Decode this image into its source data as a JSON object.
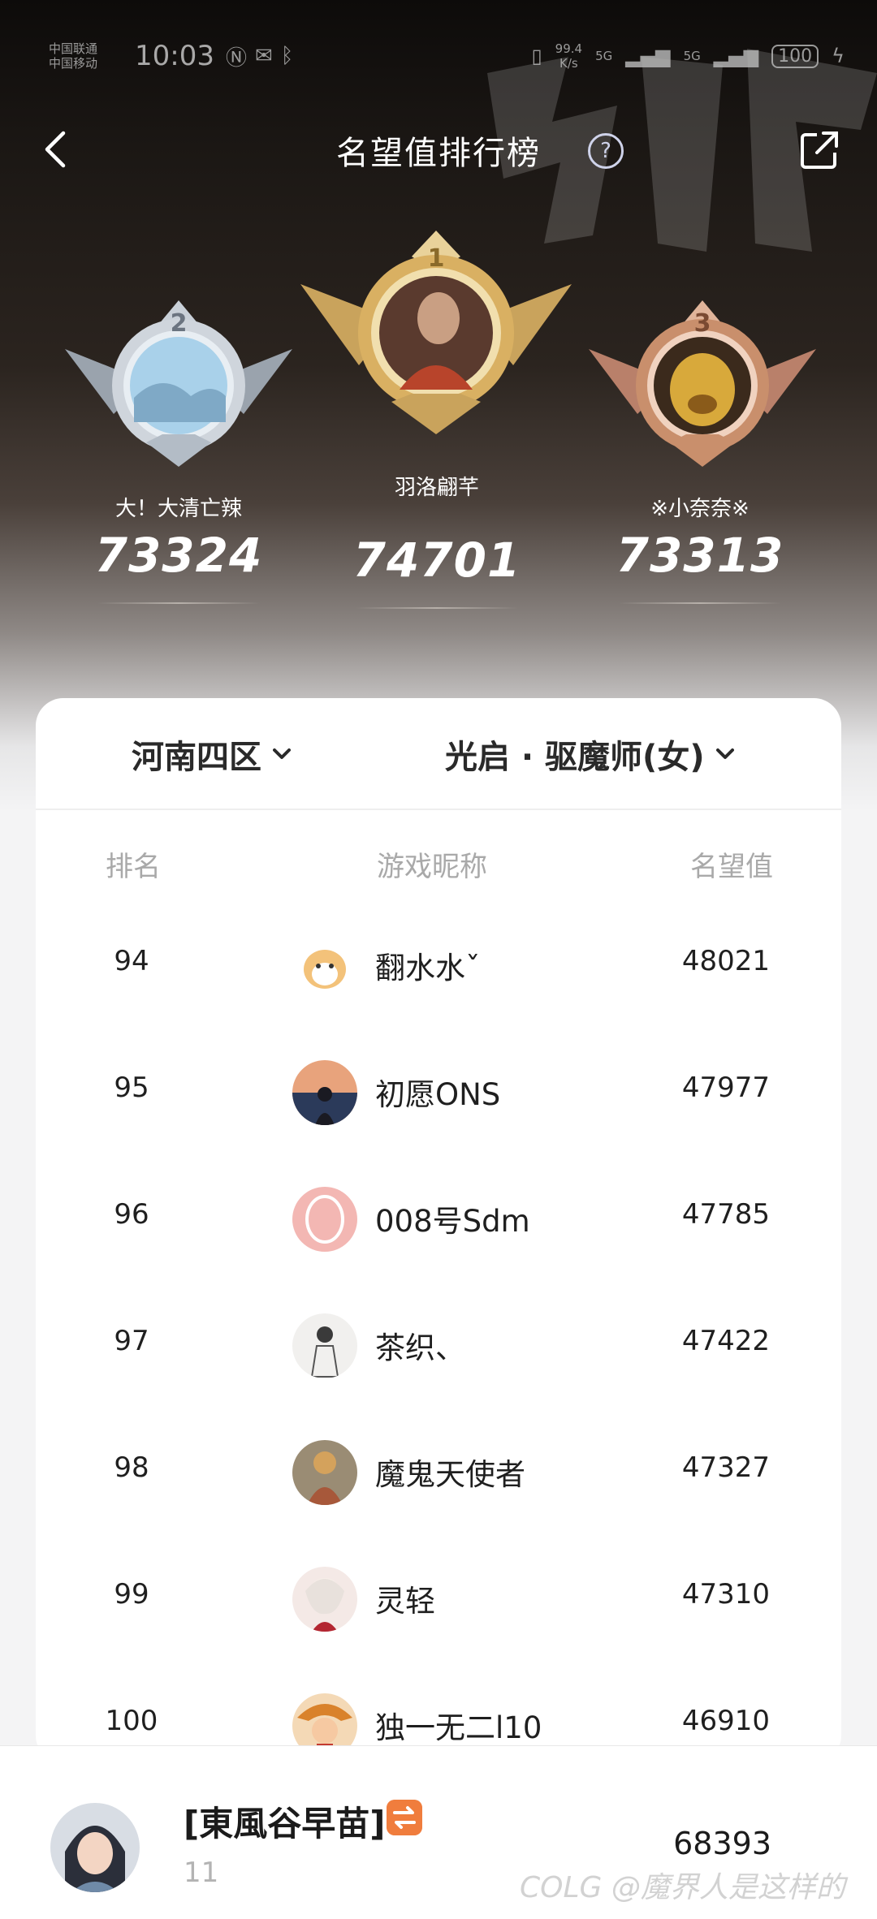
{
  "status_bar": {
    "carrier_1": "中国联通",
    "carrier_2": "中国移动",
    "time": "10:03",
    "net_speed_value": "99.4",
    "net_speed_unit": "K/s",
    "signal_1": "5G",
    "signal_2": "5G",
    "battery": "100"
  },
  "header": {
    "title": "名望值排行榜",
    "help_label": "?"
  },
  "podium": [
    {
      "rank": "2",
      "name": "大！大清亡辣",
      "score": "73324"
    },
    {
      "rank": "1",
      "name": "羽洛翩芊",
      "score": "74701"
    },
    {
      "rank": "3",
      "name": "※小奈奈※",
      "score": "73313"
    }
  ],
  "filters": {
    "server": "河南四区",
    "job": "光启 · 驱魔师(女)"
  },
  "table": {
    "headers": {
      "rank": "排名",
      "nickname": "游戏昵称",
      "score": "名望值"
    },
    "rows": [
      {
        "rank": "94",
        "nickname": "翻水水ˇ",
        "score": "48021"
      },
      {
        "rank": "95",
        "nickname": "初愿ONS",
        "score": "47977"
      },
      {
        "rank": "96",
        "nickname": "008号Sdm",
        "score": "47785"
      },
      {
        "rank": "97",
        "nickname": "茶织、",
        "score": "47422"
      },
      {
        "rank": "98",
        "nickname": "魔鬼天使者",
        "score": "47327"
      },
      {
        "rank": "99",
        "nickname": "灵轻",
        "score": "47310"
      },
      {
        "rank": "100",
        "nickname": "独一无二l10",
        "score": "46910"
      }
    ]
  },
  "me": {
    "name": "[東風谷早苗]",
    "rank": "11",
    "score": "68393"
  },
  "watermark": "COLG @魔界人是这样的",
  "colors": {
    "accent_tag": "#f07d3d",
    "gold": "#d9b062",
    "silver": "#b9c2cc",
    "bronze": "#c98f6c"
  }
}
